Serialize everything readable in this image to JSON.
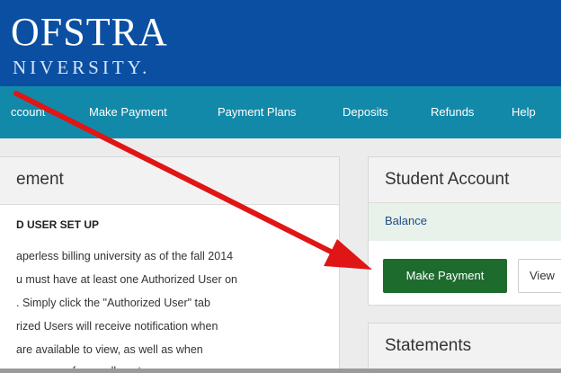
{
  "header": {
    "logo_line1": "OFSTRA",
    "logo_line2": "NIVERSITY."
  },
  "nav": {
    "items": [
      {
        "label": "ccount"
      },
      {
        "label": "Make Payment"
      },
      {
        "label": "Payment Plans"
      },
      {
        "label": "Deposits"
      },
      {
        "label": "Refunds"
      },
      {
        "label": "Help"
      }
    ]
  },
  "left_panel": {
    "title": "ement",
    "subtitle": "D USER SET UP",
    "lines": [
      "aperless billing university as of the fall 2014",
      "u must have at least one Authorized User on",
      ". Simply click the \"Authorized User\" tab",
      "rized Users will receive notification when",
      "are available to view, as well as when",
      "s are open for enrollment."
    ]
  },
  "account_panel": {
    "title": "Student Account",
    "balance_label": "Balance",
    "make_payment_label": "Make Payment",
    "view_label": "View"
  },
  "statements_panel": {
    "title": "Statements"
  },
  "colors": {
    "header_blue": "#0b4fa3",
    "nav_teal": "#1389a9",
    "button_green": "#1e6b2e",
    "arrow_red": "#e01515"
  },
  "icons": {
    "annotation": "red-arrow-icon"
  }
}
